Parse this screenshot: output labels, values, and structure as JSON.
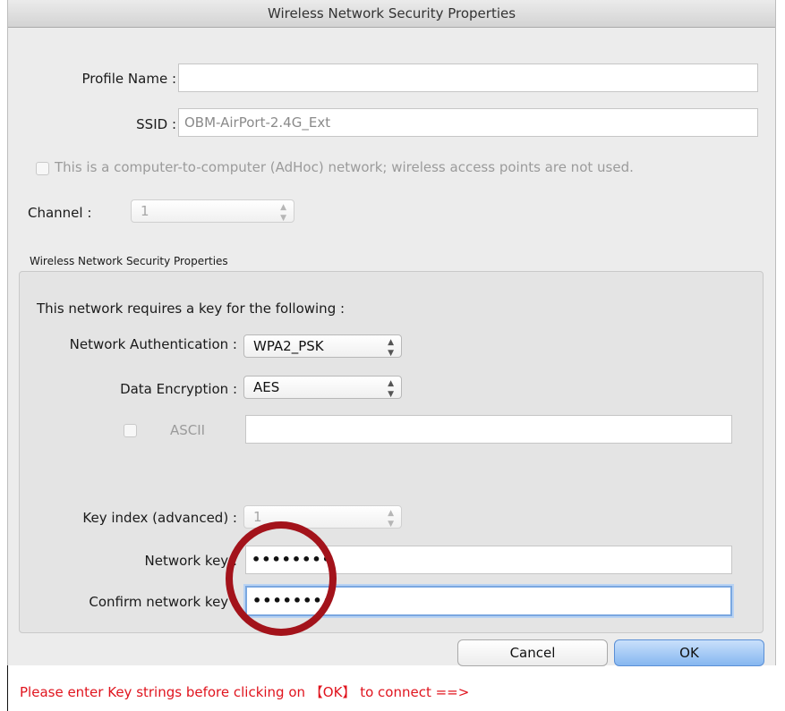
{
  "window": {
    "title": "Wireless Network Security Properties"
  },
  "profile": {
    "profile_name_label": "Profile Name :",
    "profile_name_value": "",
    "ssid_label": "SSID :",
    "ssid_value": "OBM-AirPort-2.4G_Ext",
    "adhoc_label": "This is a computer-to-computer (AdHoc) network; wireless access points are not used.",
    "adhoc_checked": false,
    "channel_label": "Channel :",
    "channel_value": "1"
  },
  "security": {
    "group_title": "Wireless Network Security Properties",
    "requires_key_text": "This network requires a key for the following :",
    "auth_label": "Network Authentication :",
    "auth_value": "WPA2_PSK",
    "encryption_label": "Data Encryption :",
    "encryption_value": "AES",
    "ascii_label": "ASCII",
    "ascii_checked": false,
    "ascii_value": "",
    "key_index_label": "Key index (advanced) :",
    "key_index_value": "1",
    "network_key_label": "Network key :",
    "network_key_value": "••••••••",
    "confirm_key_label": "Confirm network key :",
    "confirm_key_value": "••••••••"
  },
  "buttons": {
    "cancel": "Cancel",
    "ok": "OK"
  },
  "hint": "Please enter Key strings before clicking on 【OK】 to connect ==>",
  "colors": {
    "hint": "#e0141e",
    "annotation_circle": "#a3131b",
    "ok_button": "#86b7f0"
  }
}
